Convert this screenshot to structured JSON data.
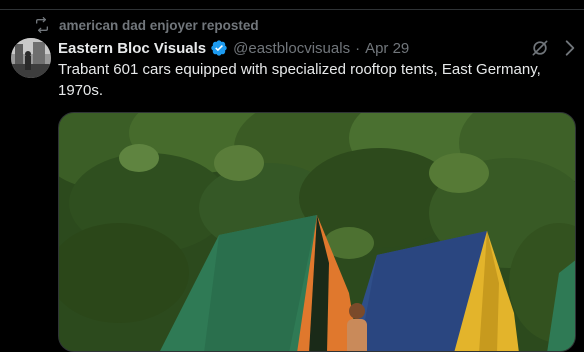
{
  "repost": {
    "text": "american dad enjoyer reposted",
    "icon": "repost-icon"
  },
  "author": {
    "display_name": "Eastern Bloc Visuals",
    "verified": true,
    "handle": "@eastblocvisuals",
    "separator": "·",
    "date": "Apr 29"
  },
  "tweet": {
    "text": "Trabant 601 cars equipped with specialized rooftop tents, East Germany, 1970s."
  },
  "icons": {
    "grok": "grok-icon",
    "more": "more-icon",
    "verified": "verified-badge-icon"
  },
  "colors": {
    "background": "#000000",
    "text_primary": "#e7e9ea",
    "text_secondary": "#71767b",
    "verified_blue": "#1d9bf0",
    "divider": "#2f3336"
  }
}
